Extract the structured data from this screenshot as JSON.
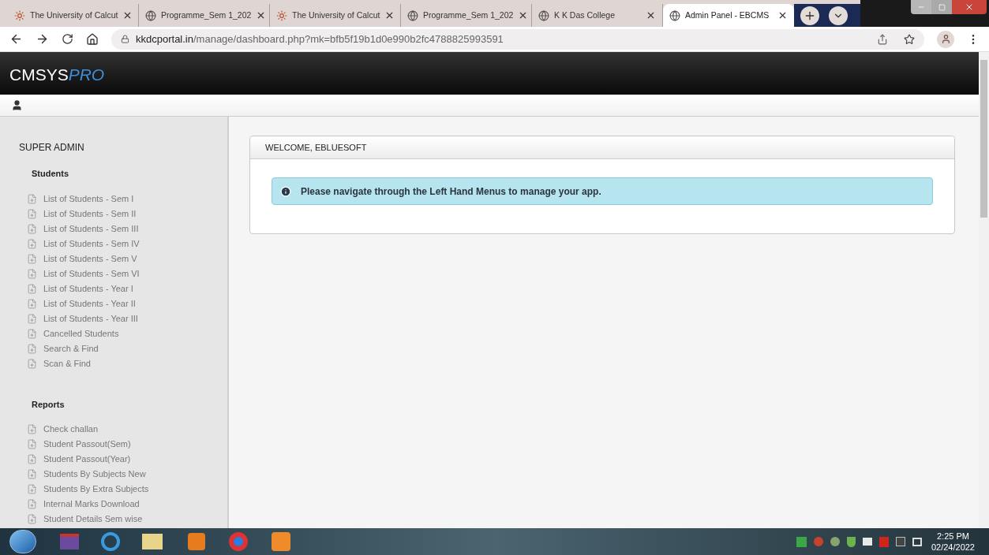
{
  "browser_tabs": [
    {
      "title": "The University of Calcut",
      "kind": "seal",
      "selected": false
    },
    {
      "title": "Programme_Sem 1_202",
      "kind": "globe",
      "selected": false
    },
    {
      "title": "The University of Calcut",
      "kind": "seal",
      "selected": false
    },
    {
      "title": "Programme_Sem 1_202",
      "kind": "globe",
      "selected": false
    },
    {
      "title": "K K Das College",
      "kind": "globe",
      "selected": false
    },
    {
      "title": "Admin Panel - EBCMS",
      "kind": "globe",
      "selected": true
    }
  ],
  "address_bar": {
    "host": "kkdcportal.in",
    "path": "/manage/dashboard.php?mk=bfb5f19b1d0e990b2fc4788825993591"
  },
  "app_header": {
    "brand": "CMSYS",
    "brand_suffix": "PRO"
  },
  "sidebar": {
    "title": "SUPER ADMIN",
    "groups": [
      {
        "heading": "Students",
        "items": [
          "List of Students - Sem I",
          "List of Students - Sem II",
          "List of Students - Sem III",
          "List of Students - Sem IV",
          "List of Students - Sem V",
          "List of Students - Sem VI",
          "List of Students - Year I",
          "List of Students - Year II",
          "List of Students - Year III",
          "Cancelled Students",
          "Search & Find",
          "Scan & Find"
        ]
      },
      {
        "heading": "Reports",
        "items": [
          "Check challan",
          "Student Passout(Sem)",
          "Student Passout(Year)",
          "Students By Subjects New",
          "Students By Extra Subjects",
          "Internal Marks Download",
          "Student Details Sem wise"
        ]
      }
    ]
  },
  "welcome_card": {
    "title": "WELCOME, EBLUESOFT",
    "alert": "Please navigate through the Left Hand Menus to manage your app."
  },
  "taskbar": {
    "time": "2:25 PM",
    "date": "02/24/2022"
  }
}
